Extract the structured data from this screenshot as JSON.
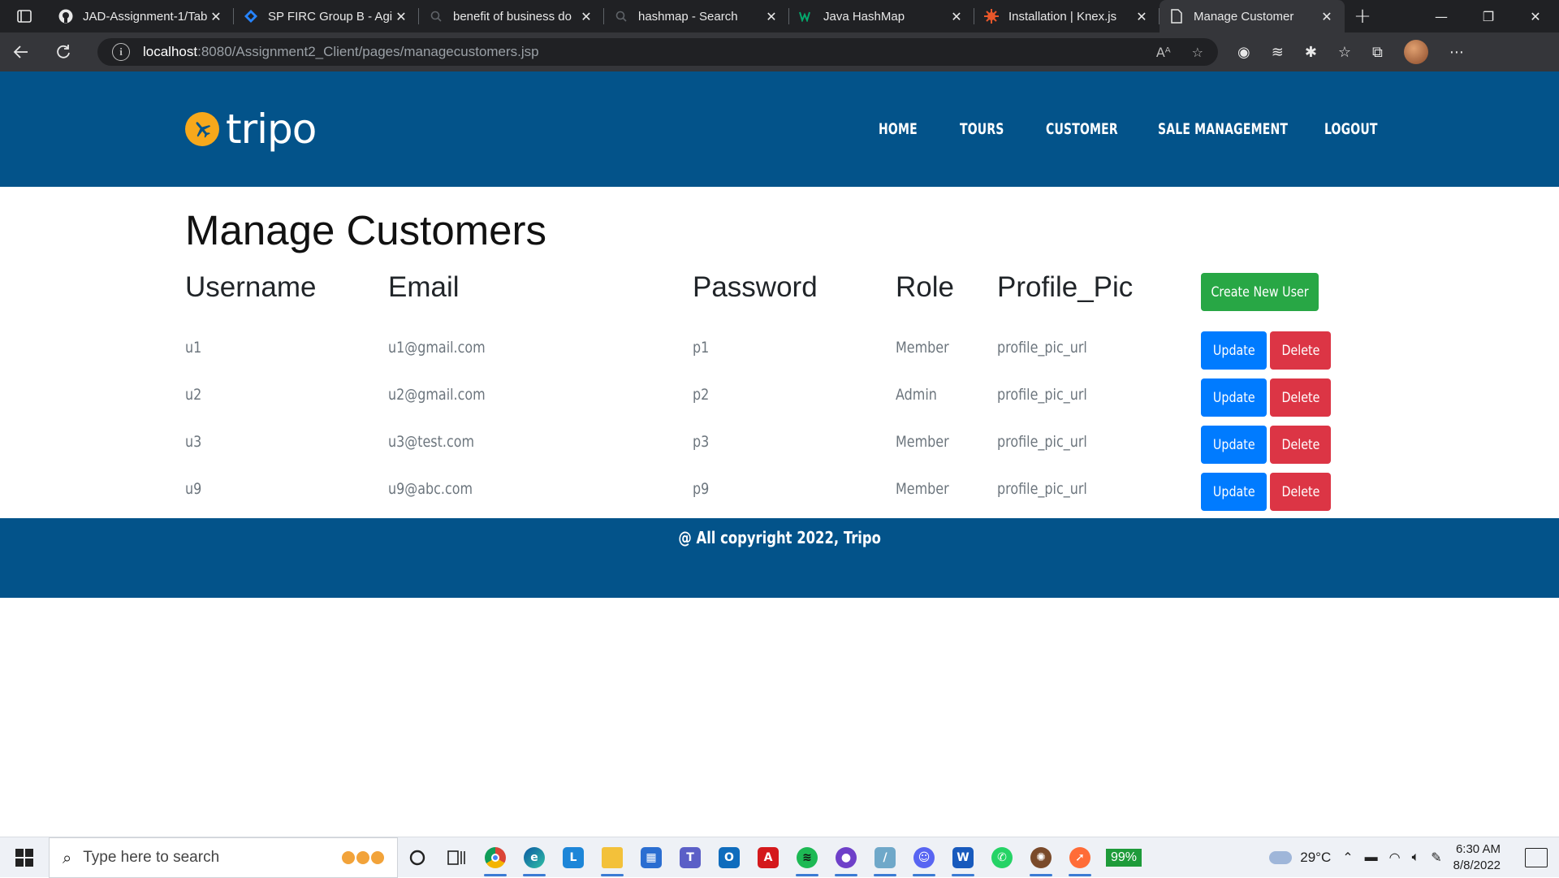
{
  "browser": {
    "tabs": [
      {
        "title": "JAD-Assignment-1/Tab",
        "icon": "github-icon"
      },
      {
        "title": "SP FIRC Group B - Agi",
        "icon": "jira-icon"
      },
      {
        "title": "benefit of business do",
        "icon": "bing-search-icon"
      },
      {
        "title": "hashmap - Search",
        "icon": "bing-search-icon"
      },
      {
        "title": "Java HashMap",
        "icon": "w3schools-icon"
      },
      {
        "title": "Installation | Knex.js",
        "icon": "knex-icon"
      },
      {
        "title": "Manage Customer",
        "icon": "page-icon",
        "active": true
      }
    ],
    "url_host": "localhost",
    "url_rest": ":8080/Assignment2_Client/pages/managecustomers.jsp"
  },
  "site": {
    "logo_text": "tripo",
    "nav": [
      "HOME",
      "TOURS",
      "CUSTOMER",
      "SALE MANAGEMENT",
      "LOGOUT"
    ],
    "page_title": "Manage Customers",
    "columns": [
      "Username",
      "Email",
      "Password",
      "Role",
      "Profile_Pic"
    ],
    "create_button": "Create New User",
    "update_label": "Update",
    "delete_label": "Delete",
    "rows": [
      {
        "username": "u1",
        "email": "u1@gmail.com",
        "password": "p1",
        "role": "Member",
        "profile_pic": "profile_pic_url"
      },
      {
        "username": "u2",
        "email": "u2@gmail.com",
        "password": "p2",
        "role": "Admin",
        "profile_pic": "profile_pic_url"
      },
      {
        "username": "u3",
        "email": "u3@test.com",
        "password": "p3",
        "role": "Member",
        "profile_pic": "profile_pic_url"
      },
      {
        "username": "u9",
        "email": "u9@abc.com",
        "password": "p9",
        "role": "Member",
        "profile_pic": "profile_pic_url"
      }
    ],
    "footer": "@ All copyright 2022, Tripo",
    "colors": {
      "brand": "#03538a",
      "accent": "#f7a81b",
      "create": "#28a745",
      "update": "#007bff",
      "delete": "#dc3545"
    }
  },
  "taskbar": {
    "search_placeholder": "Type here to search",
    "battery": "99%",
    "temperature": "29°C",
    "time": "6:30 AM",
    "date": "8/8/2022"
  }
}
